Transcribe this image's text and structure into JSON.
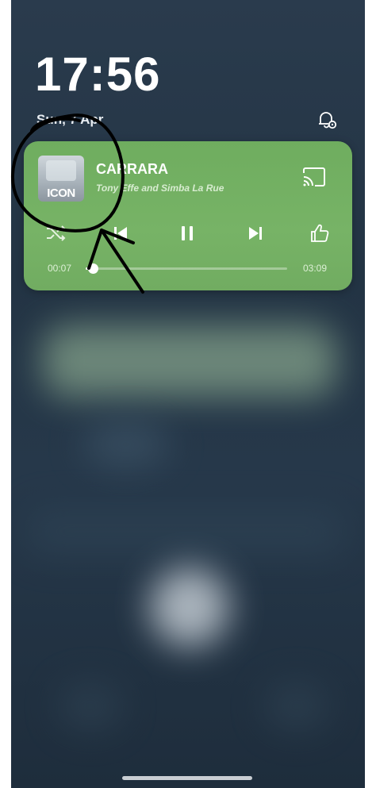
{
  "lockscreen": {
    "time": "17:56",
    "date": "Sun, 7 Apr"
  },
  "media": {
    "title": "CARRARA",
    "artist": "Tony Effe and Simba La Rue",
    "album_art_text": "ICON",
    "elapsed": "00:07",
    "duration": "03:09",
    "progress": 0.037,
    "accent_color": "#74b063"
  },
  "icons": {
    "notification_settings": "bell-gear-icon",
    "cast": "cast-icon",
    "shuffle": "shuffle-icon",
    "previous": "skip-previous-icon",
    "pause": "pause-icon",
    "next": "skip-next-icon",
    "like": "thumbs-up-icon"
  }
}
